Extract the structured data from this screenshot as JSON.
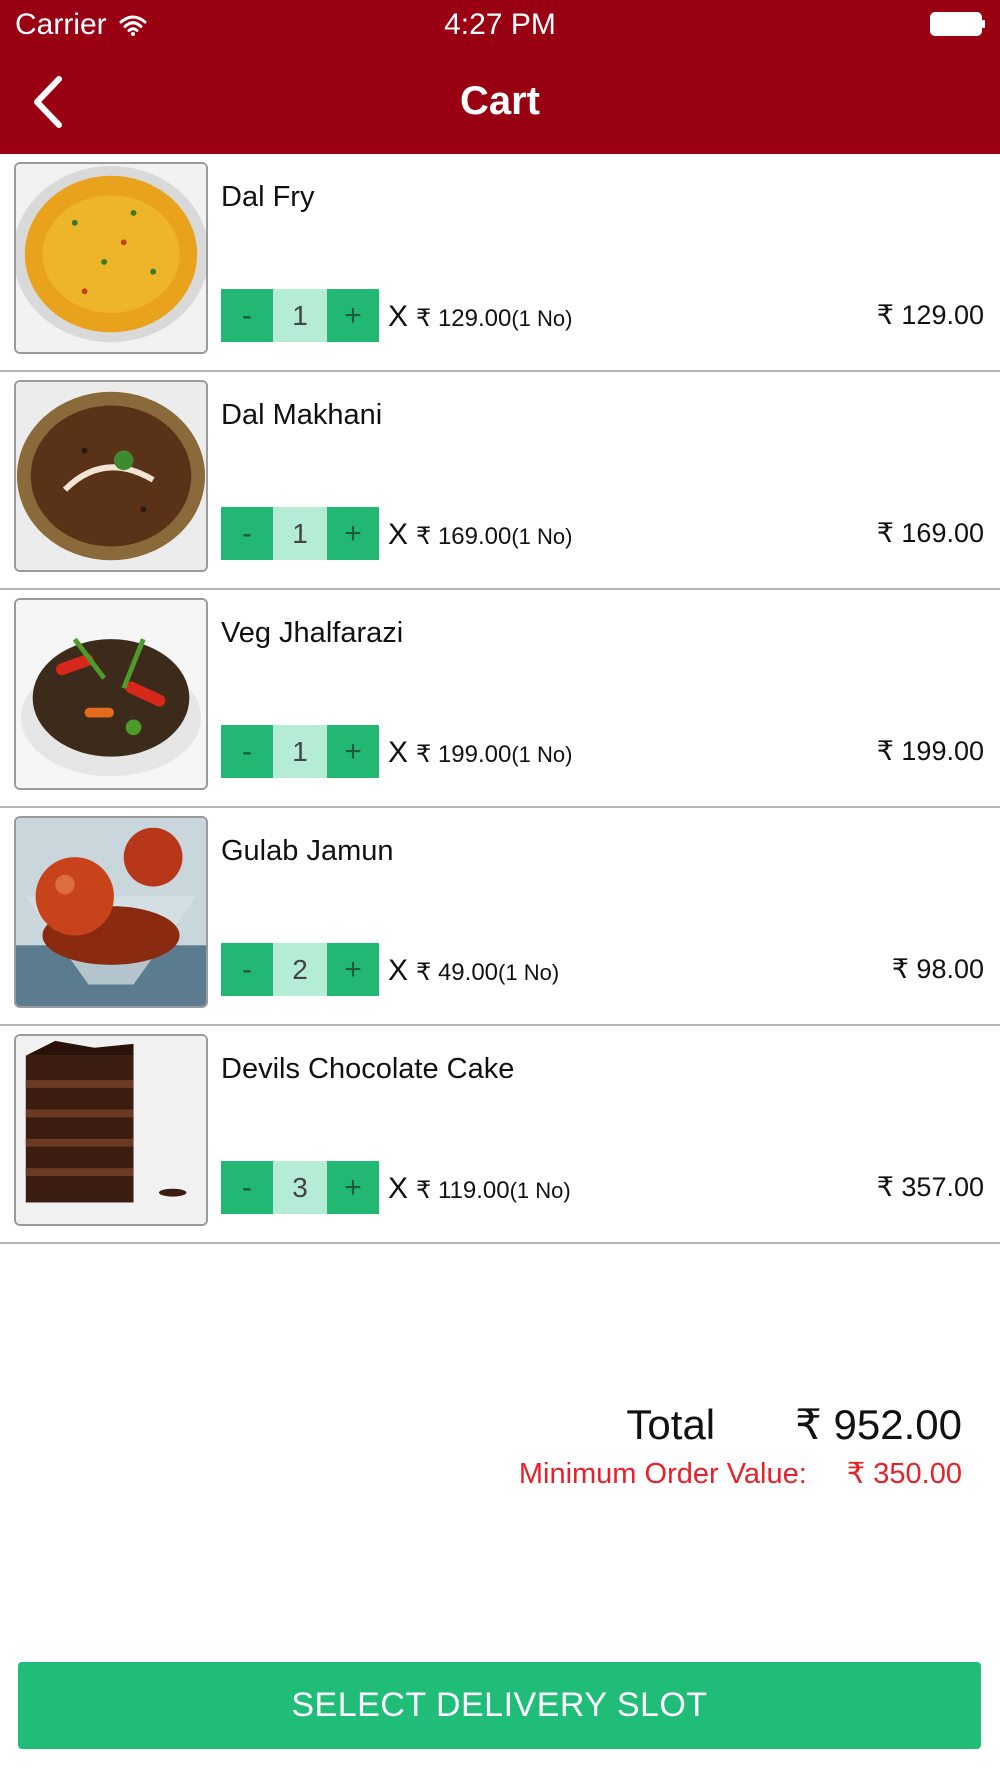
{
  "status_bar": {
    "carrier": "Carrier",
    "time": "4:27 PM"
  },
  "nav": {
    "title": "Cart"
  },
  "cart": {
    "items": [
      {
        "name": "Dal Fry",
        "qty": "1",
        "unit_price": "₹ 129.00",
        "unit_note": "(1 No)",
        "line_total": "₹ 129.00"
      },
      {
        "name": "Dal Makhani",
        "qty": "1",
        "unit_price": "₹ 169.00",
        "unit_note": "(1 No)",
        "line_total": "₹ 169.00"
      },
      {
        "name": "Veg Jhalfarazi",
        "qty": "1",
        "unit_price": "₹ 199.00",
        "unit_note": "(1 No)",
        "line_total": "₹ 199.00"
      },
      {
        "name": "Gulab Jamun",
        "qty": "2",
        "unit_price": "₹ 49.00",
        "unit_note": "(1 No)",
        "line_total": "₹ 98.00"
      },
      {
        "name": "Devils Chocolate Cake",
        "qty": "3",
        "unit_price": "₹ 119.00",
        "unit_note": "(1 No)",
        "line_total": "₹ 357.00"
      }
    ],
    "minus_label": "-",
    "plus_label": "+",
    "times_label": "X"
  },
  "summary": {
    "total_label": "Total",
    "total_value": "₹ 952.00",
    "min_order_label": "Minimum Order Value:",
    "min_order_value": "₹ 350.00"
  },
  "footer": {
    "button_label": "SELECT DELIVERY SLOT"
  },
  "colors": {
    "header_bg": "#990012",
    "accent_green": "#1fbd78",
    "qty_bg": "#b5ecd6",
    "warning_red": "#e8202a"
  }
}
